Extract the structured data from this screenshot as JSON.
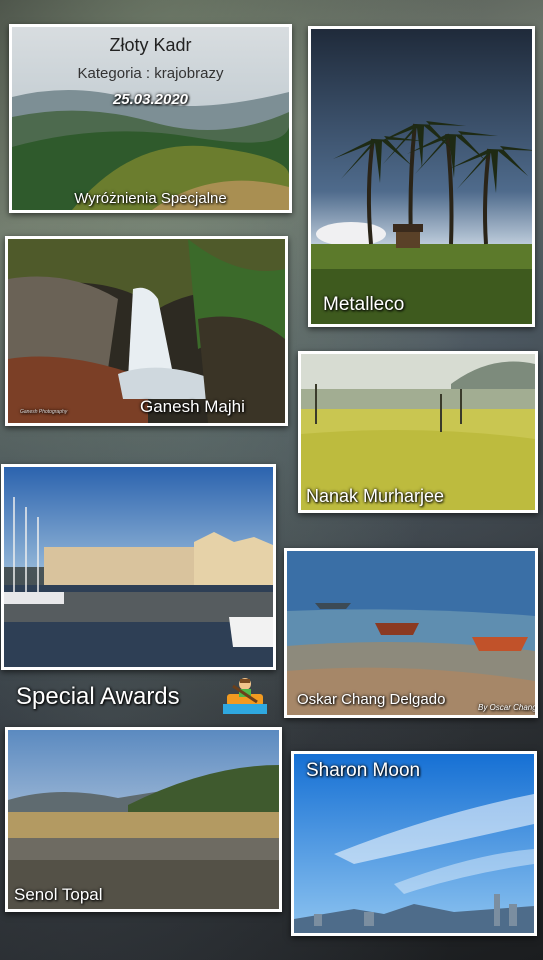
{
  "tiles": {
    "zloty": {
      "title": "Złoty Kadr",
      "category": "Kategoria : krajobrazy",
      "date": "25.03.2020",
      "caption": "Wyróżnienia Specjalne"
    },
    "metalleco": {
      "caption": "Metalleco"
    },
    "ganesh": {
      "caption": "Ganesh Majhi",
      "signature": "Ganesh Photography"
    },
    "nanak": {
      "caption": "Nanak Murharjee"
    },
    "marina": {},
    "oskar": {
      "caption": "Oskar Chang Delgado",
      "signature": "By Oscar Chang"
    },
    "senol": {
      "caption": "Senol Topal"
    },
    "sharon": {
      "caption": "Sharon Moon"
    }
  },
  "special_awards": {
    "label": "Special Awards",
    "icon": "person-rowing-boat-icon"
  }
}
